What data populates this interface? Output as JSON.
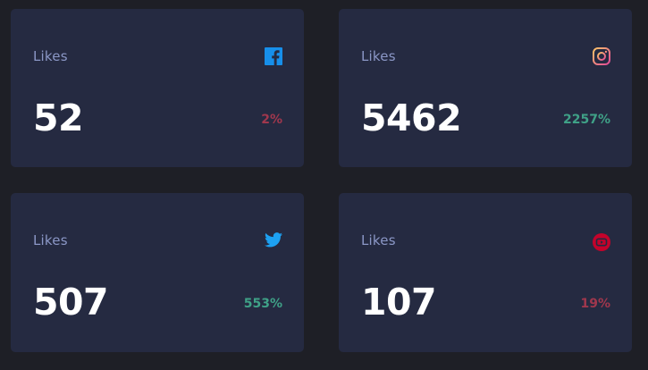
{
  "colors": {
    "background": "#1e1f26",
    "card": "#252a41",
    "label": "#8b97c6",
    "up": "#3fa187",
    "down": "#a0374d",
    "facebook": "#178fea",
    "twitter": "#1da1f2",
    "youtube": "#c4032b"
  },
  "cards": [
    {
      "label": "Likes",
      "icon": "facebook-icon",
      "value": "52",
      "change": "2%",
      "trend": "down"
    },
    {
      "label": "Likes",
      "icon": "instagram-icon",
      "value": "5462",
      "change": "2257%",
      "trend": "up"
    },
    {
      "label": "Likes",
      "icon": "twitter-icon",
      "value": "507",
      "change": "553%",
      "trend": "up"
    },
    {
      "label": "Likes",
      "icon": "youtube-icon",
      "value": "107",
      "change": "19%",
      "trend": "down"
    }
  ]
}
